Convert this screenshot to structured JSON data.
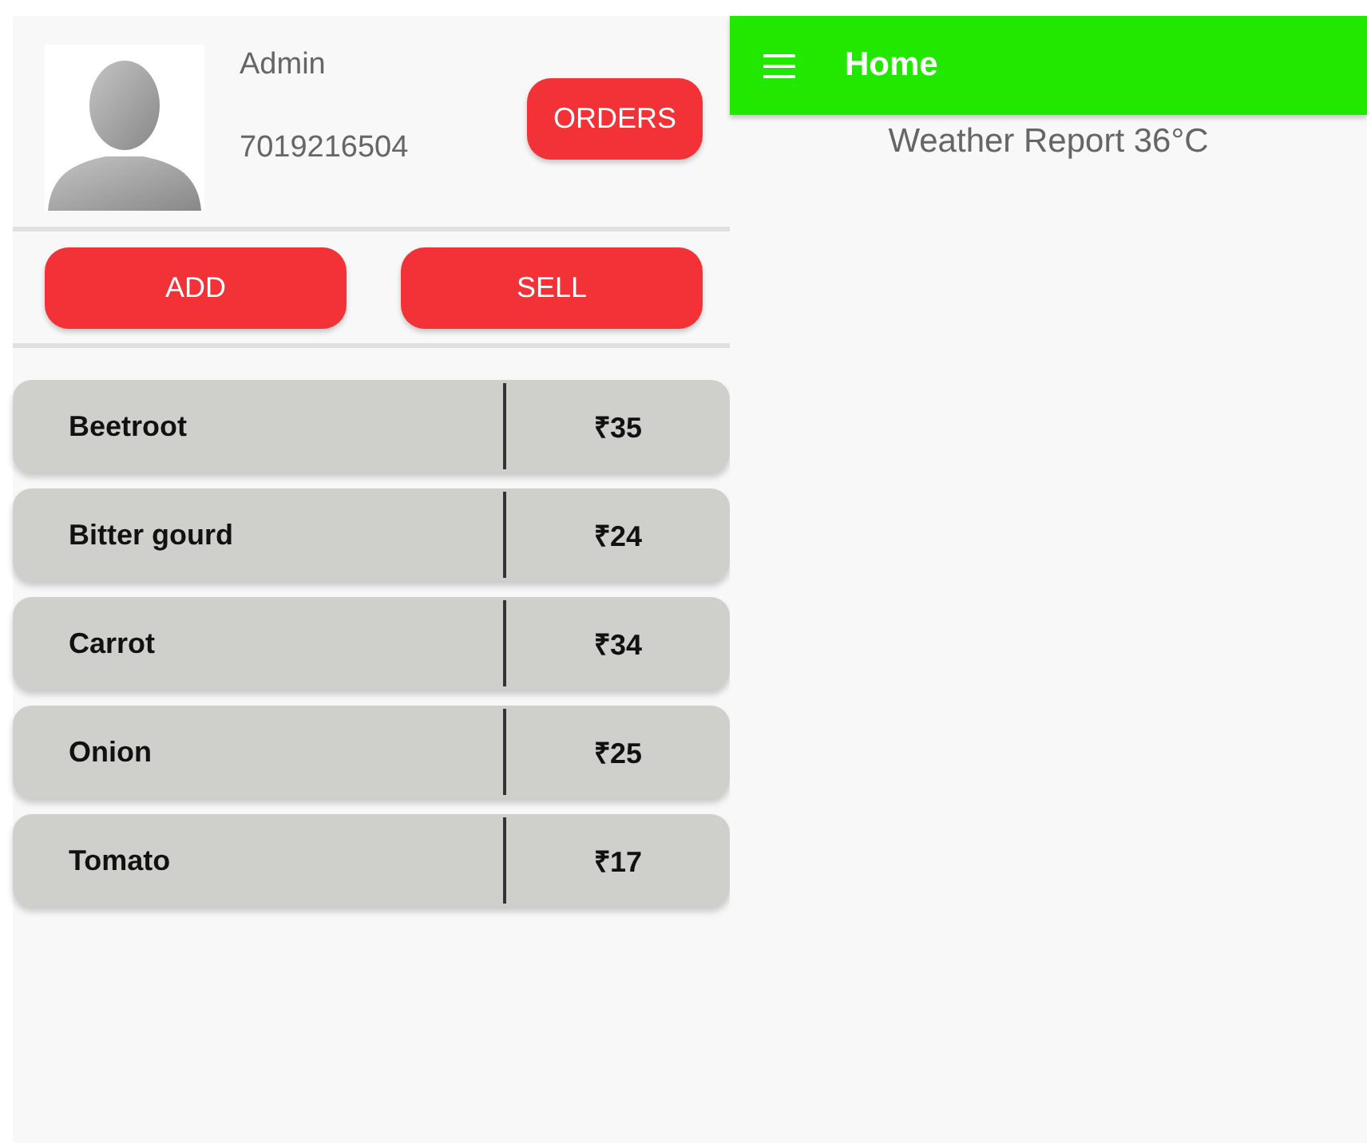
{
  "profile": {
    "name": "Admin",
    "phone": "7019216504",
    "orders_button": "ORDERS"
  },
  "actions": [
    "ADD",
    "SELL"
  ],
  "products": [
    {
      "name": "Beetroot",
      "price": "₹35"
    },
    {
      "name": "Bitter gourd",
      "price": "₹24"
    },
    {
      "name": "Carrot",
      "price": "₹34"
    },
    {
      "name": "Onion",
      "price": "₹25"
    },
    {
      "name": "Tomato",
      "price": "₹17"
    }
  ],
  "app_bar": {
    "title": "Home"
  },
  "weather": "Weather Report 36°C"
}
